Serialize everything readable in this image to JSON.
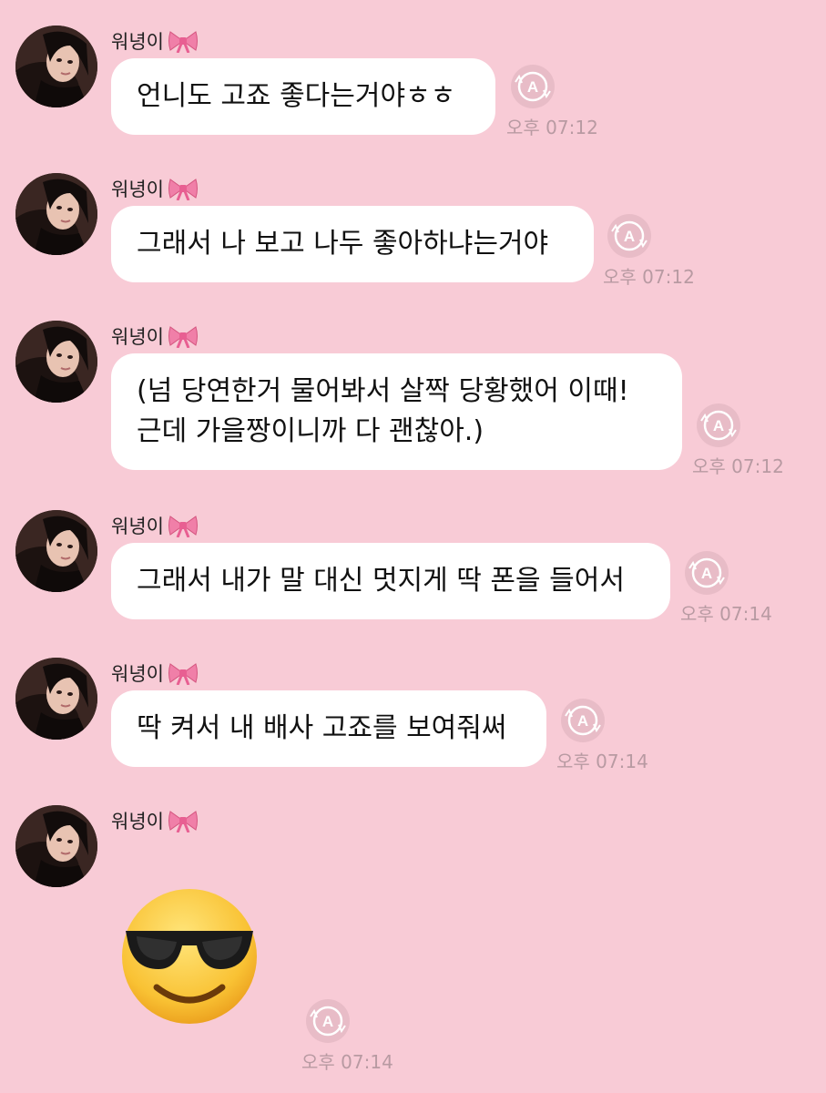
{
  "sender_name": "워녕이",
  "messages": [
    {
      "text": "언니도 고죠 좋다는거야ㅎㅎ",
      "time": "오후 07:12"
    },
    {
      "text": "그래서 나 보고 나두 좋아하냐는거야",
      "time": "오후 07:12"
    },
    {
      "text": "(넘 당연한거 물어봐서 살짝 당황했어 이때!\n근데 가을짱이니까 다 괜찮아.)",
      "time": "오후 07:12"
    },
    {
      "text": "그래서 내가 말 대신 멋지게 딱 폰을 들어서",
      "time": "오후 07:14"
    },
    {
      "text": "딱 켜서 내 배사 고죠를 보여줘써",
      "time": "오후 07:14"
    },
    {
      "emoji": "smiling-face-with-sunglasses",
      "time": "오후 07:14"
    }
  ],
  "colors": {
    "background": "#f8cbd6",
    "bubble": "#ffffff",
    "time_text": "#b89aa2",
    "read_icon": "#e3b7c2",
    "bow": "#f07fa8"
  }
}
